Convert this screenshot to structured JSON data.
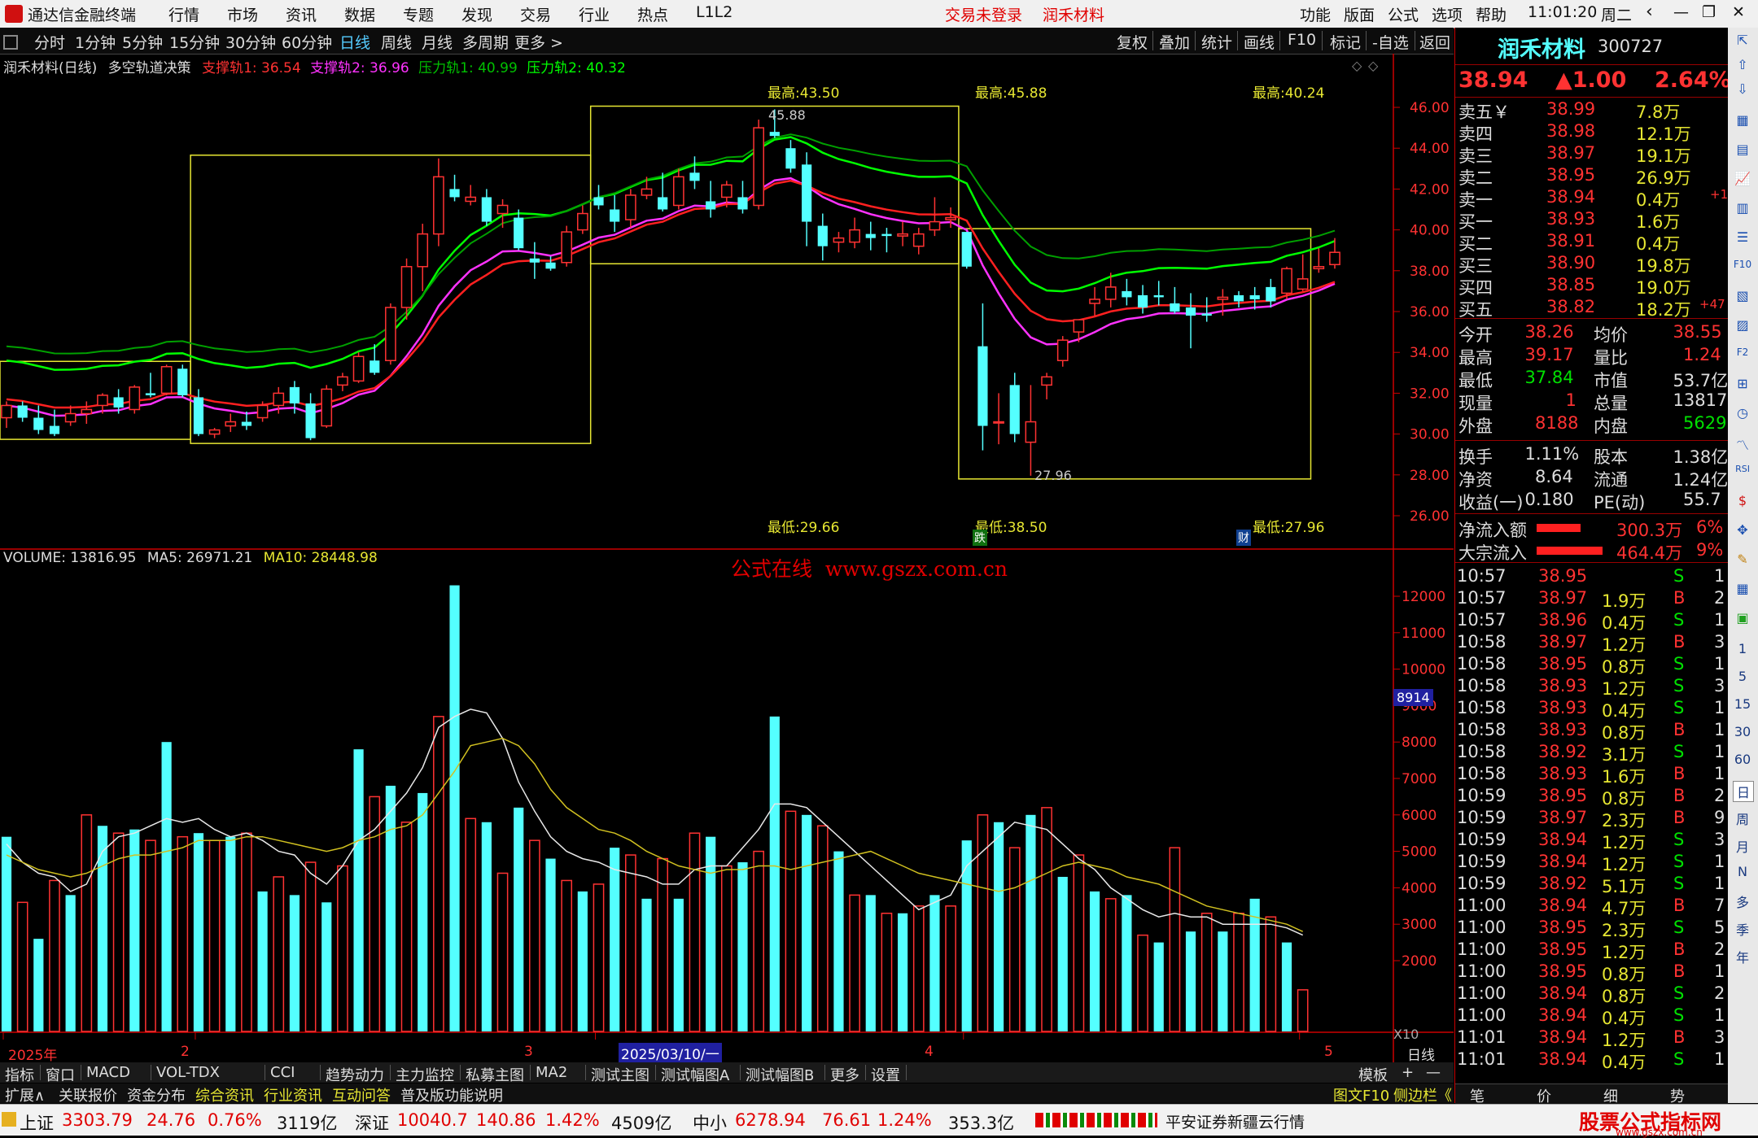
{
  "title_bar": {
    "app_name": "通达信金融终端",
    "menus": [
      "行情",
      "市场",
      "资讯",
      "数据",
      "专题",
      "发现",
      "交易",
      "行业",
      "热点",
      "L1L2"
    ],
    "trade_status": "交易未登录",
    "stock_name": "润禾材料",
    "right_menus": [
      "功能",
      "版面",
      "公式",
      "选项",
      "帮助"
    ],
    "time": "11:01:20",
    "weekday": "周二"
  },
  "toolbar": {
    "periods": [
      "分时",
      "1分钟",
      "5分钟",
      "15分钟",
      "30分钟",
      "60分钟",
      "日线",
      "周线",
      "月线",
      "多周期",
      "更多 >"
    ],
    "selected_period": "日线",
    "actions": [
      "复权",
      "叠加",
      "统计",
      "画线",
      "F10",
      "标记",
      "-自选",
      "返回"
    ]
  },
  "main_chart": {
    "header": {
      "title": "润禾材料(日线)",
      "indicator": "多空轨道决策",
      "support1": "支撑轨1: 36.54",
      "support2": "支撑轨2: 36.96",
      "pressure1": "压力轨1: 40.99",
      "pressure2": "压力轨2: 40.32"
    },
    "highs": [
      "最高:43.50",
      "最高:45.88",
      "最高:40.24"
    ],
    "lows": [
      "最低:29.66",
      "最低:38.50",
      "最低:27.96"
    ],
    "price_marks": [
      "45.88",
      "27.96"
    ],
    "y_ticks": [
      "46.00",
      "44.00",
      "42.00",
      "40.00",
      "38.00",
      "36.00",
      "34.00",
      "32.00",
      "30.00",
      "28.00",
      "26.00"
    ],
    "flags": [
      "跌",
      "财"
    ]
  },
  "volume_chart": {
    "header_volume": "VOLUME: 13816.95",
    "header_ma5": "MA5: 26971.21",
    "header_ma10": "MA10: 28448.98",
    "watermark": "公式在线  www.gszx.com.cn",
    "y_ticks": [
      "12000",
      "11000",
      "10000",
      "9000",
      "8000",
      "7000",
      "6000",
      "5000",
      "4000",
      "3000",
      "2000"
    ],
    "cursor_value": "8914",
    "unit": "X10"
  },
  "x_axis": {
    "labels": [
      "2025年",
      "2",
      "3",
      "4",
      "5"
    ],
    "cursor_date": "2025/03/10/一",
    "period_label": "日线"
  },
  "chart_data": {
    "type": "line",
    "ohlc": [
      [
        30.8,
        31.6,
        30.3,
        31.4
      ],
      [
        31.4,
        31.6,
        30.6,
        30.8
      ],
      [
        30.8,
        31.4,
        30.0,
        30.2
      ],
      [
        30.4,
        31.2,
        29.9,
        30.0
      ],
      [
        30.6,
        31.4,
        30.4,
        31.0
      ],
      [
        31.0,
        31.6,
        30.5,
        31.2
      ],
      [
        31.4,
        32.0,
        31.0,
        31.9
      ],
      [
        31.8,
        32.2,
        31.0,
        31.3
      ],
      [
        31.2,
        32.4,
        31.0,
        32.3
      ],
      [
        32.0,
        33.0,
        31.8,
        31.9
      ],
      [
        32.0,
        33.4,
        31.9,
        33.3
      ],
      [
        33.2,
        33.4,
        31.8,
        31.9
      ],
      [
        31.8,
        32.2,
        29.9,
        30.0
      ],
      [
        30.0,
        30.3,
        29.8,
        30.2
      ],
      [
        30.4,
        31.0,
        30.1,
        30.6
      ],
      [
        30.6,
        31.1,
        30.2,
        30.4
      ],
      [
        30.8,
        31.6,
        30.6,
        31.4
      ],
      [
        31.4,
        32.3,
        31.0,
        32.0
      ],
      [
        32.3,
        32.6,
        31.0,
        31.5
      ],
      [
        31.5,
        32.0,
        29.7,
        29.8
      ],
      [
        30.4,
        32.4,
        30.3,
        32.2
      ],
      [
        32.4,
        33.0,
        32.1,
        32.8
      ],
      [
        32.6,
        34.0,
        32.5,
        33.8
      ],
      [
        33.6,
        34.4,
        32.9,
        33.0
      ],
      [
        33.6,
        36.4,
        33.4,
        36.2
      ],
      [
        36.2,
        38.6,
        35.6,
        38.2
      ],
      [
        38.2,
        40.3,
        37.0,
        39.8
      ],
      [
        39.8,
        43.5,
        39.2,
        42.6
      ],
      [
        42.0,
        42.7,
        41.4,
        41.6
      ],
      [
        41.4,
        42.2,
        41.2,
        41.6
      ],
      [
        41.6,
        42.0,
        40.2,
        40.4
      ],
      [
        40.8,
        41.5,
        40.1,
        41.2
      ],
      [
        40.6,
        41.0,
        39.0,
        39.1
      ],
      [
        38.6,
        39.4,
        37.6,
        38.4
      ],
      [
        38.4,
        38.7,
        38.0,
        38.1
      ],
      [
        38.4,
        40.2,
        38.2,
        39.9
      ],
      [
        40.0,
        41.2,
        39.8,
        40.8
      ],
      [
        41.6,
        42.2,
        41.0,
        41.2
      ],
      [
        41.0,
        41.7,
        39.9,
        40.4
      ],
      [
        40.5,
        42.0,
        40.1,
        41.7
      ],
      [
        41.7,
        42.6,
        41.5,
        42.0
      ],
      [
        41.6,
        42.8,
        40.9,
        41.0
      ],
      [
        41.2,
        43.0,
        41.0,
        42.6
      ],
      [
        42.8,
        43.6,
        42.0,
        42.4
      ],
      [
        41.4,
        42.4,
        40.6,
        41.0
      ],
      [
        41.6,
        42.4,
        41.1,
        42.2
      ],
      [
        41.6,
        42.4,
        40.8,
        41.0
      ],
      [
        41.2,
        45.4,
        41.0,
        45.0
      ],
      [
        44.8,
        45.9,
        44.5,
        44.6
      ],
      [
        44.0,
        44.4,
        42.8,
        43.0
      ],
      [
        43.2,
        43.8,
        39.2,
        40.4
      ],
      [
        40.2,
        40.8,
        38.5,
        39.2
      ],
      [
        39.4,
        39.9,
        38.9,
        39.6
      ],
      [
        39.4,
        40.6,
        39.1,
        40.0
      ],
      [
        39.8,
        40.4,
        39.0,
        39.6
      ],
      [
        39.8,
        40.1,
        38.9,
        39.7
      ],
      [
        39.7,
        40.4,
        39.2,
        39.8
      ],
      [
        39.2,
        40.1,
        38.8,
        39.8
      ],
      [
        40.0,
        41.6,
        39.7,
        40.4
      ],
      [
        40.5,
        41.1,
        40.1,
        40.6
      ],
      [
        39.9,
        39.9,
        38.1,
        38.2
      ],
      [
        34.3,
        36.4,
        29.2,
        30.4
      ],
      [
        30.6,
        32.0,
        29.5,
        30.6
      ],
      [
        32.4,
        33.0,
        29.6,
        30.0
      ],
      [
        29.6,
        32.4,
        27.96,
        30.6
      ],
      [
        32.4,
        33.0,
        31.7,
        32.8
      ],
      [
        33.6,
        34.8,
        33.3,
        34.6
      ],
      [
        35.0,
        35.6,
        34.5,
        35.6
      ],
      [
        36.4,
        37.2,
        35.8,
        36.6
      ],
      [
        36.6,
        37.9,
        36.2,
        37.2
      ],
      [
        37.0,
        37.6,
        36.3,
        36.7
      ],
      [
        36.8,
        37.3,
        35.9,
        36.2
      ],
      [
        36.8,
        37.5,
        36.3,
        36.7
      ],
      [
        36.4,
        37.2,
        35.9,
        36.0
      ],
      [
        36.2,
        36.9,
        34.2,
        35.8
      ],
      [
        35.9,
        36.7,
        35.5,
        35.8
      ],
      [
        36.6,
        37.1,
        35.8,
        36.7
      ],
      [
        36.8,
        37.0,
        36.2,
        36.5
      ],
      [
        36.8,
        37.2,
        36.1,
        36.6
      ],
      [
        37.2,
        37.6,
        36.2,
        36.5
      ],
      [
        36.9,
        38.2,
        36.6,
        38.1
      ],
      [
        37.1,
        38.8,
        37.0,
        37.6
      ],
      [
        38.1,
        39.1,
        37.9,
        38.2
      ],
      [
        38.3,
        39.6,
        38.1,
        38.9
      ]
    ],
    "volume": [
      5400,
      3600,
      2600,
      4200,
      3800,
      6000,
      5700,
      5500,
      5600,
      5300,
      8000,
      5400,
      5500,
      5300,
      5400,
      5500,
      3900,
      4300,
      3800,
      4700,
      3600,
      4600,
      7800,
      6500,
      6800,
      5800,
      6600,
      8700,
      12300,
      5900,
      5800,
      4400,
      6200,
      5300,
      4800,
      4200,
      3900,
      4100,
      5100,
      4900,
      3700,
      4800,
      3700,
      5500,
      5400,
      4600,
      4700,
      5000,
      8700,
      6100,
      6000,
      5700,
      5000,
      3800,
      3800,
      3300,
      3300,
      3500,
      3800,
      3500,
      5300,
      6000,
      5800,
      5100,
      6000,
      6200,
      4300,
      4900,
      3900,
      3700,
      3800,
      2700,
      2500,
      5100,
      2800,
      3300,
      2800,
      3300,
      3700,
      3200,
      2500,
      1200
    ],
    "volume_up": [
      false,
      true,
      false,
      true,
      false,
      true,
      false,
      true,
      false,
      true,
      false,
      true,
      false,
      true,
      false,
      true,
      false,
      true,
      false,
      true,
      false,
      true,
      false,
      true,
      false,
      true,
      false,
      true,
      false,
      true,
      false,
      true,
      false,
      true,
      false,
      true,
      false,
      true,
      false,
      true,
      false,
      true,
      false,
      true,
      false,
      true,
      false,
      true,
      false,
      true,
      false,
      true,
      false,
      true,
      false,
      true,
      false,
      true,
      false,
      true,
      false,
      true,
      false,
      true,
      false,
      true,
      false,
      true,
      false,
      true,
      false,
      true,
      false,
      true,
      false,
      true,
      false,
      true,
      false,
      true,
      false,
      true
    ],
    "ma5": [
      5200,
      4700,
      4400,
      4300,
      3900,
      4100,
      5000,
      5400,
      5500,
      5700,
      5900,
      5800,
      5900,
      5600,
      5400,
      5500,
      5300,
      5000,
      4900,
      4400,
      4100,
      4600,
      5300,
      5600,
      6100,
      6600,
      7300,
      8400,
      8700,
      8900,
      8800,
      8100,
      6900,
      6100,
      5400,
      5000,
      4800,
      4700,
      4500,
      4400,
      4300,
      4100,
      4100,
      4500,
      4600,
      4600,
      5100,
      5600,
      6300,
      6300,
      6200,
      5800,
      5400,
      5000,
      4600,
      4200,
      3800,
      3400,
      3600,
      3800,
      4600,
      5000,
      5400,
      5800,
      5700,
      5600,
      5200,
      4800,
      4500,
      4000,
      3700,
      3400,
      3200,
      3300,
      3200,
      3200,
      3000,
      3000,
      3000,
      3000,
      2900,
      2700
    ],
    "ma10": [
      4900,
      4700,
      4500,
      4400,
      4300,
      4400,
      4600,
      4800,
      4900,
      4900,
      5000,
      5100,
      5300,
      5300,
      5300,
      5400,
      5400,
      5300,
      5200,
      5100,
      5000,
      5100,
      5300,
      5400,
      5600,
      5700,
      6000,
      6600,
      7200,
      7900,
      8000,
      8100,
      7900,
      7400,
      6700,
      6200,
      5900,
      5600,
      5500,
      5300,
      5000,
      4800,
      4600,
      4500,
      4400,
      4500,
      4500,
      4600,
      4600,
      4500,
      4600,
      4700,
      4800,
      4900,
      5000,
      4800,
      4600,
      4400,
      4300,
      4200,
      4100,
      4000,
      3900,
      4000,
      4200,
      4400,
      4600,
      4700,
      4600,
      4500,
      4300,
      4200,
      4100,
      3900,
      3700,
      3500,
      3400,
      3300,
      3200,
      3100,
      3000,
      2800
    ]
  },
  "quote_panel": {
    "name": "润禾材料",
    "code": "300727",
    "price": "38.94",
    "change": "▲1.00",
    "change_pct": "2.64%",
    "sells": [
      {
        "label": "卖五￥",
        "price": "38.99",
        "vol": "7.8万",
        "extra": ""
      },
      {
        "label": "卖四",
        "price": "38.98",
        "vol": "12.1万",
        "extra": ""
      },
      {
        "label": "卖三",
        "price": "38.97",
        "vol": "19.1万",
        "extra": ""
      },
      {
        "label": "卖二",
        "price": "38.95",
        "vol": "26.9万",
        "extra": ""
      },
      {
        "label": "卖一",
        "price": "38.94",
        "vol": "0.4万",
        "extra": "+1"
      }
    ],
    "buys": [
      {
        "label": "买一",
        "price": "38.93",
        "vol": "1.6万",
        "extra": ""
      },
      {
        "label": "买二",
        "price": "38.91",
        "vol": "0.4万",
        "extra": ""
      },
      {
        "label": "买三",
        "price": "38.90",
        "vol": "19.8万",
        "extra": ""
      },
      {
        "label": "买四",
        "price": "38.85",
        "vol": "19.0万",
        "extra": ""
      },
      {
        "label": "买五",
        "price": "38.82",
        "vol": "18.2万",
        "extra": "+47"
      }
    ],
    "stats": [
      {
        "l1": "今开",
        "v1": "38.26",
        "l2": "均价",
        "v2": "38.55"
      },
      {
        "l1": "最高",
        "v1": "39.17",
        "l2": "量比",
        "v2": "1.24"
      },
      {
        "l1": "最低",
        "v1": "37.84",
        "l2": "市值",
        "v2": "53.7亿"
      },
      {
        "l1": "现量",
        "v1": "1",
        "l2": "总量",
        "v2": "13817"
      },
      {
        "l1": "外盘",
        "v1": "8188",
        "l2": "内盘",
        "v2": "5629"
      }
    ],
    "stats2": [
      {
        "l1": "换手",
        "v1": "1.11%",
        "l2": "股本",
        "v2": "1.38亿"
      },
      {
        "l1": "净资",
        "v1": "8.64",
        "l2": "流通",
        "v2": "1.24亿"
      },
      {
        "l1": "收益(一)",
        "v1": "0.180",
        "l2": "PE(动)",
        "v2": "55.7"
      }
    ],
    "flows": [
      {
        "label": "净流入额",
        "value": "300.3万",
        "pct": "6%",
        "bar": 0.6
      },
      {
        "label": "大宗流入",
        "value": "464.4万",
        "pct": "9%",
        "bar": 0.9
      }
    ],
    "ticks": [
      [
        "10:57",
        "38.95",
        "",
        "S",
        "1"
      ],
      [
        "10:57",
        "38.97",
        "1.9万",
        "B",
        "2"
      ],
      [
        "10:57",
        "38.96",
        "0.4万",
        "S",
        "1"
      ],
      [
        "10:58",
        "38.97",
        "1.2万",
        "B",
        "3"
      ],
      [
        "10:58",
        "38.95",
        "0.8万",
        "S",
        "1"
      ],
      [
        "10:58",
        "38.93",
        "1.2万",
        "S",
        "3"
      ],
      [
        "10:58",
        "38.93",
        "0.4万",
        "S",
        "1"
      ],
      [
        "10:58",
        "38.93",
        "0.8万",
        "B",
        "1"
      ],
      [
        "10:58",
        "38.92",
        "3.1万",
        "S",
        "1"
      ],
      [
        "10:58",
        "38.93",
        "1.6万",
        "B",
        "1"
      ],
      [
        "10:59",
        "38.95",
        "0.8万",
        "B",
        "2"
      ],
      [
        "10:59",
        "38.97",
        "2.3万",
        "B",
        "9"
      ],
      [
        "10:59",
        "38.94",
        "1.2万",
        "S",
        "3"
      ],
      [
        "10:59",
        "38.94",
        "1.2万",
        "S",
        "1"
      ],
      [
        "10:59",
        "38.92",
        "5.1万",
        "S",
        "1"
      ],
      [
        "11:00",
        "38.94",
        "4.7万",
        "B",
        "7"
      ],
      [
        "11:00",
        "38.95",
        "2.3万",
        "S",
        "5"
      ],
      [
        "11:00",
        "38.95",
        "1.2万",
        "B",
        "2"
      ],
      [
        "11:00",
        "38.95",
        "0.8万",
        "B",
        "1"
      ],
      [
        "11:00",
        "38.94",
        "0.8万",
        "S",
        "2"
      ],
      [
        "11:00",
        "38.94",
        "0.4万",
        "S",
        "1"
      ],
      [
        "11:01",
        "38.94",
        "1.2万",
        "B",
        "3"
      ],
      [
        "11:01",
        "38.94",
        "0.4万",
        "S",
        "1"
      ]
    ],
    "bottom_tabs": [
      "笔",
      "价",
      "细",
      "势"
    ]
  },
  "right_sidebar": [
    "1",
    "5",
    "15",
    "30",
    "60",
    "日",
    "周",
    "月",
    "N",
    "多",
    "季",
    "年"
  ],
  "tabs_row1": [
    "指标",
    "窗口",
    "MACD",
    "VOL-TDX",
    "CCI",
    "趋势动力",
    "主力监控",
    "私募主图",
    "MA2",
    "测试主图",
    "测试幅图A",
    "测试幅图B",
    "更多",
    "设置"
  ],
  "tabs_row1_right": [
    "模板",
    "+",
    "—"
  ],
  "tabs_row2": [
    "扩展∧",
    "关联报价",
    "资金分布",
    "综合资讯",
    "行业资讯",
    "互动问答",
    "普及版功能说明"
  ],
  "tabs_row2_right": [
    "图文F10",
    "侧边栏《"
  ],
  "status_bar": {
    "sh_label": "上证",
    "sh_val": "3303.79",
    "sh_chg": "24.76",
    "sh_pct": "0.76%",
    "sh_amt": "3119亿",
    "sz_label": "深证",
    "sz_val": "10040.7",
    "sz_chg": "140.86",
    "sz_pct": "1.42%",
    "sz_amt": "4509亿",
    "zx_label": "中小",
    "zx_val": "6278.94",
    "zx_chg": "76.61",
    "zx_pct": "1.24%",
    "zx_amt": "353.3亿",
    "broker": "平安证券新疆云行情",
    "brand": "股票公式指标网",
    "brand_url": "www.gszx.com.cn"
  },
  "colors": {
    "up": "#ff3232",
    "down": "#54ffff",
    "yellow": "#e6e632",
    "green": "#00e000",
    "accent_red": "#e00000"
  }
}
